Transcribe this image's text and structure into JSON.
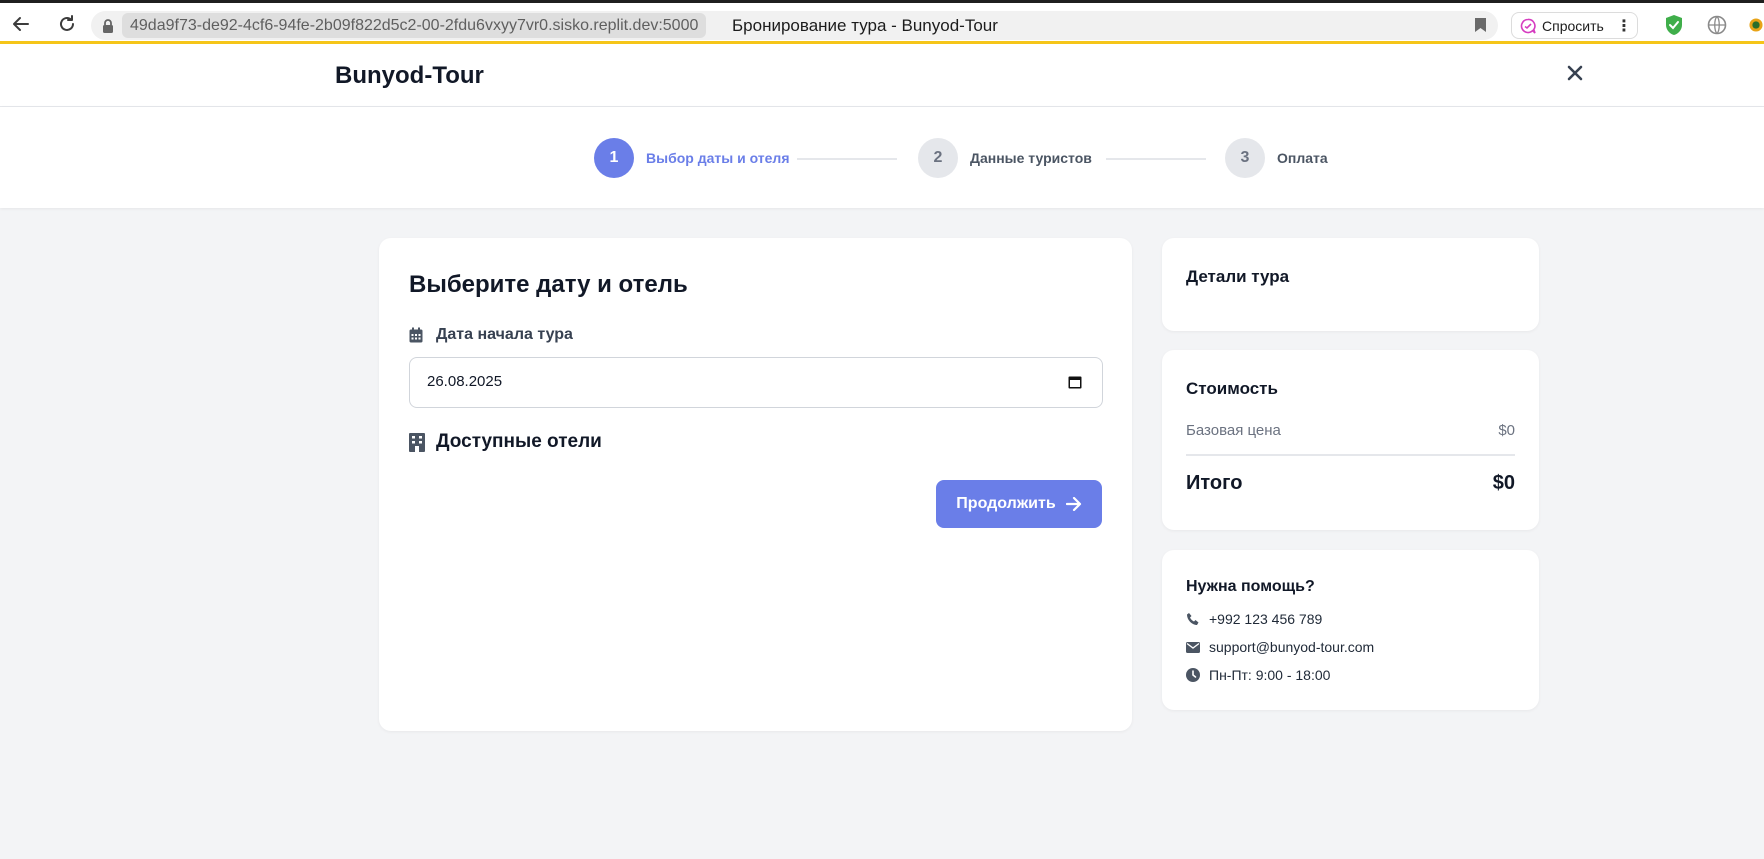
{
  "browser": {
    "url": "49da9f73-de92-4cf6-94fe-2b09f822d5c2-00-2fdu6vxyy7vr0.sisko.replit.dev:5000",
    "tab_title": "Бронирование тура - Bunyod-Tour",
    "ask_label": "Спросить",
    "accent": "#f5c518"
  },
  "header": {
    "brand": "Bunyod-Tour"
  },
  "stepper": {
    "steps": [
      {
        "number": "1",
        "label": "Выбор даты и отеля",
        "state": "active"
      },
      {
        "number": "2",
        "label": "Данные туристов",
        "state": "idle"
      },
      {
        "number": "3",
        "label": "Оплата",
        "state": "idle"
      }
    ],
    "active_color": "#6a7ee8"
  },
  "main": {
    "title": "Выберите дату и отель",
    "date_label": "Дата начала тура",
    "date_value": "26.08.2025",
    "hotels_title": "Доступные отели",
    "continue_label": "Продолжить"
  },
  "sidebar": {
    "details_title": "Детали тура",
    "cost_title": "Стоимость",
    "base_price_label": "Базовая цена",
    "base_price_value": "$0",
    "total_label": "Итого",
    "total_value": "$0",
    "help_title": "Нужна помощь?",
    "phone": "+992 123 456 789",
    "email": "support@bunyod-tour.com",
    "hours": "Пн-Пт: 9:00 - 18:00"
  },
  "icons": [
    "back-arrow-icon",
    "reload-icon",
    "lock-icon",
    "bookmark-icon",
    "ask-ai-icon",
    "more-vert-icon",
    "shield-extension-icon",
    "globe-extension-icon",
    "close-icon",
    "calendar-icon",
    "building-icon",
    "arrow-right-icon",
    "phone-icon",
    "envelope-icon",
    "clock-icon"
  ]
}
